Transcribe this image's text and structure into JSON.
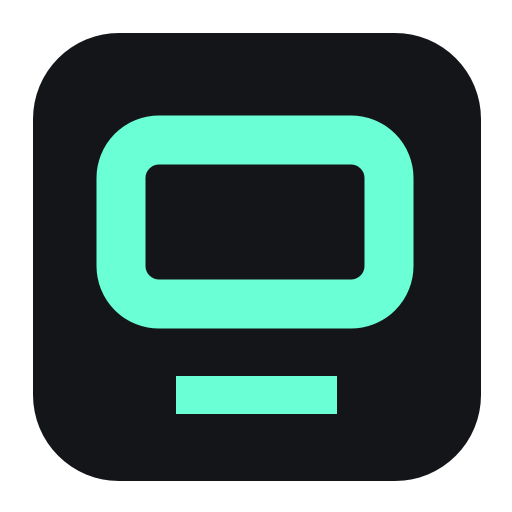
{
  "icon": {
    "name": "monitor-icon",
    "colors": {
      "background": "#141518",
      "accent": "#6BFFD6"
    }
  }
}
